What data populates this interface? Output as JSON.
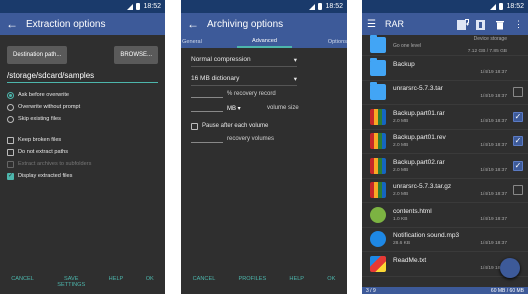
{
  "status": {
    "time": "18:52"
  },
  "panel1": {
    "title": "Extraction options",
    "destination_button": "Destination path...",
    "browse_button": "BROWSE...",
    "path_value": "/storage/sdcard/samples",
    "radios": [
      {
        "label": "Ask before overwrite",
        "checked": true
      },
      {
        "label": "Overwrite without prompt",
        "checked": false
      },
      {
        "label": "Skip existing files",
        "checked": false
      }
    ],
    "checkboxes": [
      {
        "label": "Keep broken files",
        "checked": false,
        "disabled": false
      },
      {
        "label": "Do not extract paths",
        "checked": false,
        "disabled": false
      },
      {
        "label": "Extract archives to subfolders",
        "checked": false,
        "disabled": true
      },
      {
        "label": "Display extracted files",
        "checked": true,
        "disabled": false
      }
    ],
    "footer": [
      "CANCEL",
      "SAVE SETTINGS",
      "HELP",
      "OK"
    ]
  },
  "panel2": {
    "title": "Archiving options",
    "tabs": [
      "General",
      "Advanced",
      "Options"
    ],
    "active_tab": "Advanced",
    "compression": "Normal compression",
    "dictionary": "16 MB dictionary",
    "recovery_suffix": "% recovery record",
    "volume_unit": "MB",
    "volume_label": "volume size",
    "pause_label": "Pause after each volume",
    "recovery_volumes": "recovery volumes",
    "footer": [
      "CANCEL",
      "PROFILES",
      "HELP",
      "OK"
    ]
  },
  "panel3": {
    "title": "RAR",
    "up_label": "Go one level",
    "device_storage": "Device storage",
    "storage_free": "7.12 GB / 7.85 GB",
    "files": [
      {
        "name": "Backup",
        "date": "1/4/19 18:37",
        "size": "",
        "type": "folder",
        "checked": null
      },
      {
        "name": "unrarsrc-5.7.3.tar",
        "date": "1/4/19 18:37",
        "size": "",
        "type": "folder",
        "checked": false
      },
      {
        "name": "Backup.part01.rar",
        "date": "1/4/19 18:37",
        "size": "2.0 MB",
        "type": "rar",
        "checked": true
      },
      {
        "name": "Backup.part01.rev",
        "date": "1/4/19 18:37",
        "size": "2.0 MB",
        "type": "rar",
        "checked": true
      },
      {
        "name": "Backup.part02.rar",
        "date": "1/4/19 18:37",
        "size": "2.0 MB",
        "type": "rar",
        "checked": true
      },
      {
        "name": "unrarsrc-5.7.3.tar.gz",
        "date": "1/4/19 18:37",
        "size": "2.0 MB",
        "type": "rar",
        "checked": false
      },
      {
        "name": "contents.html",
        "date": "1/4/19 18:37",
        "size": "1.0 KB",
        "type": "html",
        "checked": null
      },
      {
        "name": "Notification sound.mp3",
        "date": "1/4/19 18:37",
        "size": "28.6 KB",
        "type": "mp3",
        "checked": null
      },
      {
        "name": "ReadMe.txt",
        "date": "1/4/19 18:37",
        "size": "",
        "type": "txt",
        "checked": null
      }
    ],
    "bottom_left": "3 / 9",
    "bottom_right": "60 MB / 60 MB"
  }
}
